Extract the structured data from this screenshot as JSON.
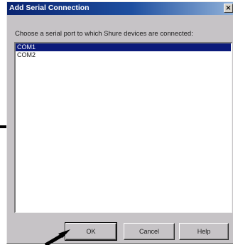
{
  "dialog": {
    "title": "Add Serial Connection",
    "close_label": "×",
    "instruction": "Choose a serial port to which Shure devices are connected:"
  },
  "ports": {
    "items": [
      {
        "label": "COM1",
        "selected": true
      },
      {
        "label": "COM2",
        "selected": false
      }
    ]
  },
  "buttons": {
    "ok": "OK",
    "cancel": "Cancel",
    "help": "Help"
  },
  "colors": {
    "title_bar": "#0a2470",
    "selection": "#0b1a7a",
    "dialog_face": "#c6c3c6"
  }
}
